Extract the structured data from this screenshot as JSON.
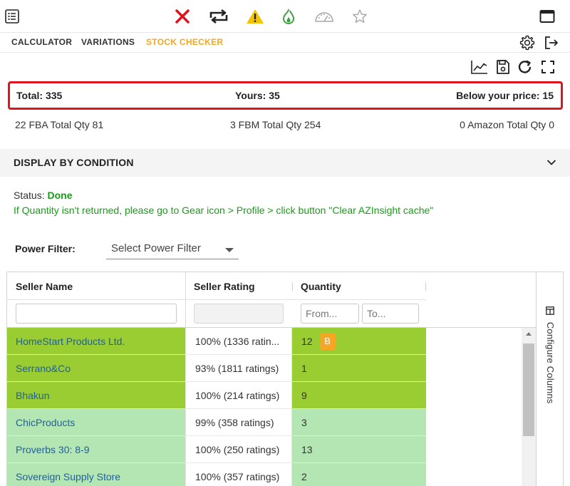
{
  "tabs": [
    {
      "label": "CALCULATOR",
      "active": false
    },
    {
      "label": "VARIATIONS",
      "active": false
    },
    {
      "label": "STOCK CHECKER",
      "active": true
    }
  ],
  "toolbar_icons": [
    "list-icon",
    "close-icon",
    "repeat-icon",
    "warning-icon",
    "flame-icon",
    "gauge-icon",
    "star-icon",
    "window-icon"
  ],
  "totals": {
    "total": "Total: 335",
    "yours": "Yours: 35",
    "below": "Below your price: 15"
  },
  "summary": {
    "fba": "22 FBA Total Qty 81",
    "fbm": "3 FBM Total Qty 254",
    "amazon": "0 Amazon Total Qty 0"
  },
  "condition": {
    "title": "DISPLAY BY CONDITION"
  },
  "status": {
    "label": "Status:",
    "value": "Done",
    "hint": "If Quantity isn't returned, please go to Gear icon > Profile > click button \"Clear AZInsight cache\""
  },
  "power_filter": {
    "label": "Power Filter:",
    "placeholder": "Select Power Filter"
  },
  "table": {
    "headers": {
      "seller": "Seller Name",
      "rating": "Seller Rating",
      "quantity": "Quantity"
    },
    "filters": {
      "qty_from": "From...",
      "qty_to": "To..."
    },
    "rows": [
      {
        "name": "HomeStart Products Ltd.",
        "rating": "100% (1336 ratin...",
        "qty": "12",
        "badge": "B",
        "shade": "dark"
      },
      {
        "name": "Serrano&Co",
        "rating": "93% (1811 ratings)",
        "qty": "1",
        "badge": "",
        "shade": "dark"
      },
      {
        "name": "Bhakun",
        "rating": "100% (214 ratings)",
        "qty": "9",
        "badge": "",
        "shade": "dark"
      },
      {
        "name": "ChicProducts",
        "rating": "99% (358 ratings)",
        "qty": "3",
        "badge": "",
        "shade": "light"
      },
      {
        "name": "Proverbs 30: 8-9",
        "rating": "100% (250 ratings)",
        "qty": "13",
        "badge": "",
        "shade": "light"
      },
      {
        "name": "Sovereign Supply Store",
        "rating": "100% (357 ratings)",
        "qty": "2",
        "badge": "",
        "shade": "light"
      }
    ],
    "configure": "Configure Columns"
  },
  "colors": {
    "accent": "#f5a623",
    "alert": "#e0141e",
    "status_green": "#1a9a1a",
    "row_dark": "#9acd32",
    "row_light": "#b3e6b3",
    "link": "#1f5fa8"
  }
}
